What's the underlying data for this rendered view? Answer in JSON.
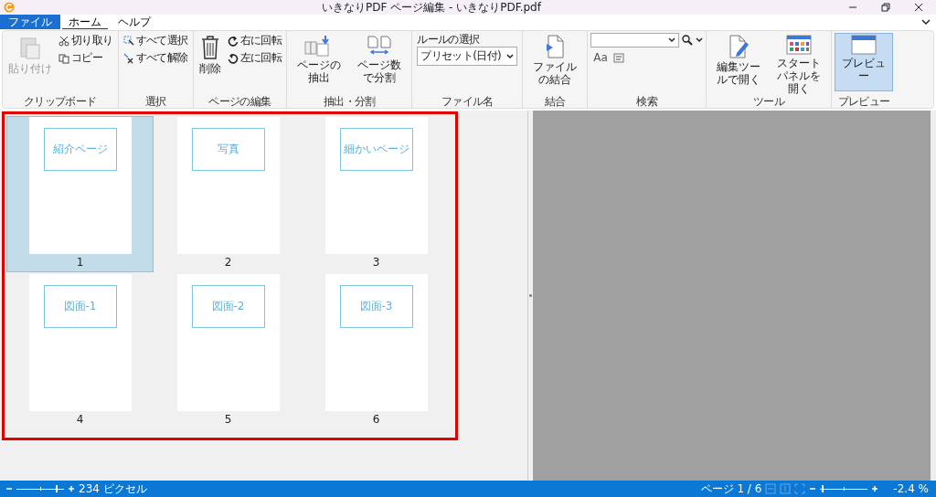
{
  "window": {
    "title": "いきなりPDF ページ編集 - いきなりPDF.pdf"
  },
  "menu_tabs": [
    {
      "label": "ファイル",
      "kind": "file",
      "selected": false
    },
    {
      "label": "ホーム",
      "kind": "tab",
      "selected": true
    },
    {
      "label": "ヘルプ",
      "kind": "tab",
      "selected": false
    }
  ],
  "ribbon": [
    {
      "label": "クリップボード",
      "items": [
        {
          "kind": "large",
          "label": "貼り付け",
          "disabled": true
        },
        {
          "kind": "small",
          "label": "切り取り",
          "disabled": false
        },
        {
          "kind": "small",
          "label": "コピー",
          "disabled": false
        }
      ]
    },
    {
      "label": "選択",
      "items": [
        {
          "kind": "small",
          "label": "すべて選択",
          "disabled": false
        },
        {
          "kind": "small",
          "label": "すべて解除",
          "disabled": false
        }
      ]
    },
    {
      "label": "ページの編集",
      "items": [
        {
          "kind": "large",
          "label": "削除",
          "disabled": false
        },
        {
          "kind": "small",
          "label": "右に回転",
          "disabled": false
        },
        {
          "kind": "small",
          "label": "左に回転",
          "disabled": false
        }
      ]
    },
    {
      "label": "抽出・分割",
      "items": [
        {
          "kind": "large",
          "label": "ページの抽出",
          "disabled": false
        },
        {
          "kind": "large",
          "label": "ページ数で分割",
          "disabled": false
        }
      ]
    },
    {
      "label": "ファイル名",
      "items": [
        {
          "kind": "select",
          "label": "ルールの選択",
          "value": "プリセット(日付)",
          "disabled": false
        }
      ]
    },
    {
      "label": "結合",
      "items": [
        {
          "kind": "large",
          "label": "ファイルの結合",
          "disabled": false
        }
      ]
    },
    {
      "label": "検索",
      "items": [
        {
          "kind": "search",
          "label": "Aa",
          "disabled": false
        }
      ]
    },
    {
      "label": "ツール",
      "items": [
        {
          "kind": "large",
          "label": "編集ツールで開く",
          "disabled": false
        },
        {
          "kind": "large",
          "label": "スタートパネルを開く",
          "disabled": false
        }
      ]
    },
    {
      "label": "プレビュー",
      "items": [
        {
          "kind": "large",
          "label": "プレビュー",
          "disabled": false,
          "selected": true
        }
      ]
    }
  ],
  "pages": [
    {
      "number": "1",
      "heading": "紹介ページ",
      "selected": true
    },
    {
      "number": "2",
      "heading": "写真",
      "selected": false
    },
    {
      "number": "3",
      "heading": "細かいページ",
      "selected": false
    },
    {
      "number": "4",
      "heading": "図面-1",
      "selected": false
    },
    {
      "number": "5",
      "heading": "図面-2",
      "selected": false
    },
    {
      "number": "6",
      "heading": "図面-3",
      "selected": false
    }
  ],
  "status_bar": {
    "thumb_slider": {
      "level": 0.85
    },
    "thumb_size": "234 ピクセル",
    "page": "ページ 1 / 6",
    "zoom_slider": {
      "level": 0.05
    },
    "zoom": "-2.4 %"
  }
}
